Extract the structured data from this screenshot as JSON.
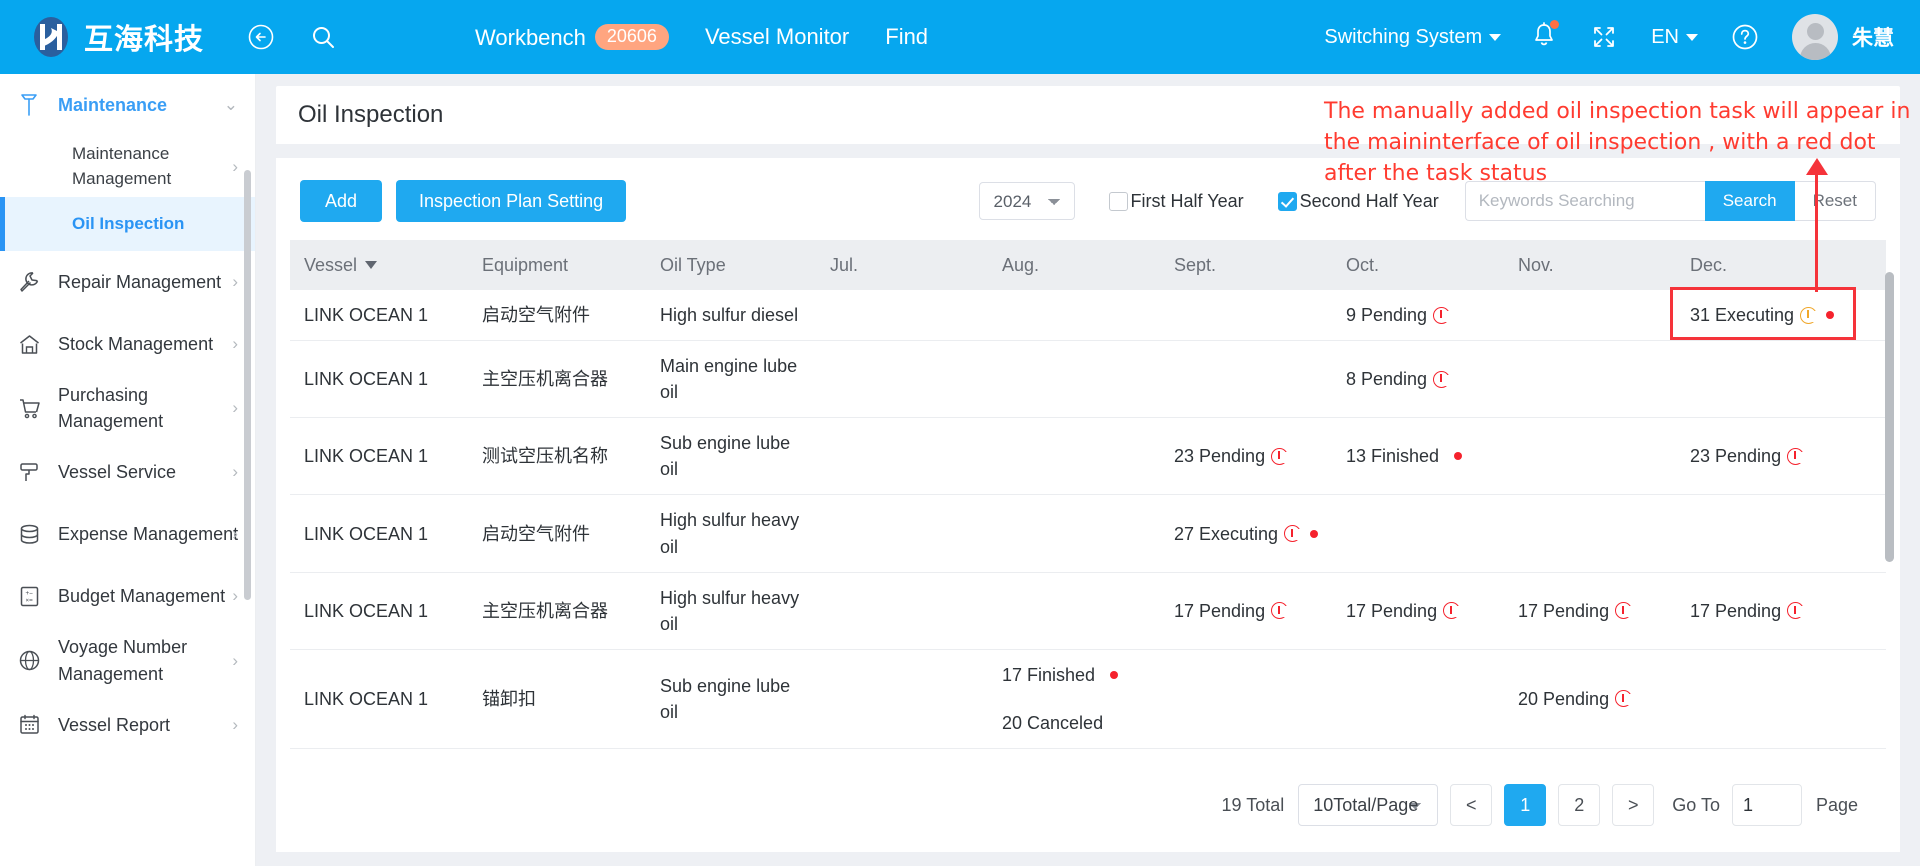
{
  "topbar": {
    "brand_name": "互海科技",
    "back_icon": "back-arrow-icon",
    "search_icon": "search-icon",
    "nav": [
      {
        "label": "Workbench",
        "badge": "20606"
      },
      {
        "label": "Vessel Monitor",
        "badge": ""
      },
      {
        "label": "Find",
        "badge": ""
      }
    ],
    "switch_system": "Switching System",
    "bell_icon": "bell-icon",
    "fullscreen_icon": "fullscreen-icon",
    "language": "EN",
    "help_icon": "help-circle-icon",
    "user_name": "朱慧"
  },
  "sidebar": {
    "groups": [
      {
        "label": "Maintenance",
        "icon": "maintenance-icon",
        "active": true,
        "children": [
          {
            "label": "Maintenance Management",
            "selected": false,
            "chevron": true
          },
          {
            "label": "Oil Inspection",
            "selected": true,
            "chevron": false
          }
        ]
      },
      {
        "label": "Repair Management",
        "icon": "wrench-icon",
        "active": false,
        "children": []
      },
      {
        "label": "Stock Management",
        "icon": "home-icon",
        "active": false,
        "children": []
      },
      {
        "label": "Purchasing Management",
        "icon": "cart-icon",
        "active": false,
        "children": []
      },
      {
        "label": "Vessel Service",
        "icon": "roller-icon",
        "active": false,
        "children": []
      },
      {
        "label": "Expense Management",
        "icon": "database-icon",
        "active": false,
        "children": []
      },
      {
        "label": "Budget Management",
        "icon": "calculator-icon",
        "active": false,
        "children": []
      },
      {
        "label": "Voyage Number Management",
        "icon": "globe-icon",
        "active": false,
        "children": []
      },
      {
        "label": "Vessel Report",
        "icon": "calendar-icon",
        "active": false,
        "children": []
      }
    ]
  },
  "page": {
    "title": "Oil Inspection"
  },
  "toolbar": {
    "add_label": "Add",
    "plan_setting_label": "Inspection Plan Setting",
    "year_value": "2024",
    "year_options": [
      "2024"
    ],
    "first_half_label": "First Half Year",
    "first_half_checked": false,
    "second_half_label": "Second Half Year",
    "second_half_checked": true,
    "search_placeholder": "Keywords Searching",
    "search_value": "",
    "search_label": "Search",
    "reset_label": "Reset"
  },
  "table": {
    "columns": [
      "Vessel",
      "Equipment",
      "Oil Type",
      "Jul.",
      "Aug.",
      "Sept.",
      "Oct.",
      "Nov.",
      "Dec."
    ],
    "sort_column": "Vessel",
    "rows": [
      {
        "vessel": "LINK OCEAN 1",
        "equipment": "启动空气附件",
        "oil_type": "High sulfur diesel",
        "jul": [],
        "aug": [],
        "sept": [],
        "oct": [
          {
            "text": "9 Pending",
            "icon": "clock-icon",
            "icon_color": "red",
            "dot": false
          }
        ],
        "nov": [],
        "dec": [
          {
            "text": "31 Executing",
            "icon": "clock-icon",
            "icon_color": "orange",
            "dot": true
          }
        ]
      },
      {
        "vessel": "LINK OCEAN 1",
        "equipment": "主空压机离合器",
        "oil_type": "Main engine lube oil",
        "jul": [],
        "aug": [],
        "sept": [],
        "oct": [
          {
            "text": "8 Pending",
            "icon": "clock-icon",
            "icon_color": "red",
            "dot": false
          }
        ],
        "nov": [],
        "dec": []
      },
      {
        "vessel": "LINK OCEAN 1",
        "equipment": "测试空压机名称",
        "oil_type": "Sub engine lube oil",
        "jul": [],
        "aug": [],
        "sept": [
          {
            "text": "23 Pending",
            "icon": "clock-icon",
            "icon_color": "red",
            "dot": false
          }
        ],
        "oct": [
          {
            "text": "13 Finished",
            "icon": "",
            "icon_color": "",
            "dot": true
          }
        ],
        "nov": [],
        "dec": [
          {
            "text": "23 Pending",
            "icon": "clock-icon",
            "icon_color": "red",
            "dot": false
          }
        ]
      },
      {
        "vessel": "LINK OCEAN 1",
        "equipment": "启动空气附件",
        "oil_type": "High sulfur heavy oil",
        "jul": [],
        "aug": [],
        "sept": [
          {
            "text": "27 Executing",
            "icon": "clock-icon",
            "icon_color": "red",
            "dot": true
          }
        ],
        "oct": [],
        "nov": [],
        "dec": []
      },
      {
        "vessel": "LINK OCEAN 1",
        "equipment": "主空压机离合器",
        "oil_type": "High sulfur heavy oil",
        "jul": [],
        "aug": [],
        "sept": [
          {
            "text": "17 Pending",
            "icon": "clock-icon",
            "icon_color": "red",
            "dot": false
          }
        ],
        "oct": [
          {
            "text": "17 Pending",
            "icon": "clock-icon",
            "icon_color": "red",
            "dot": false
          }
        ],
        "nov": [
          {
            "text": "17 Pending",
            "icon": "clock-icon",
            "icon_color": "red",
            "dot": false
          }
        ],
        "dec": [
          {
            "text": "17 Pending",
            "icon": "clock-icon",
            "icon_color": "red",
            "dot": false
          }
        ]
      },
      {
        "vessel": "LINK OCEAN 1",
        "equipment": "锚卸扣",
        "oil_type": "Sub engine lube oil",
        "jul": [],
        "aug": [
          {
            "text": "17 Finished",
            "icon": "",
            "icon_color": "",
            "dot": true
          },
          {
            "text": "20 Canceled",
            "icon": "",
            "icon_color": "",
            "dot": false
          }
        ],
        "sept": [],
        "oct": [],
        "nov": [
          {
            "text": "20 Pending",
            "icon": "clock-icon",
            "icon_color": "red",
            "dot": false
          }
        ],
        "dec": []
      }
    ]
  },
  "pagination": {
    "total_label": "19 Total",
    "page_size": "10Total/Page",
    "page_size_options": [
      "10Total/Page"
    ],
    "prev_label": "<",
    "pages": [
      "1",
      "2"
    ],
    "current_page": "1",
    "next_label": ">",
    "goto_label": "Go To",
    "goto_value": "1",
    "page_label": "Page"
  },
  "annotation": {
    "text": "The manually added oil inspection task will appear in the maininterface of oil inspection , with a red dot after the task status",
    "color": "#ff3b30"
  }
}
